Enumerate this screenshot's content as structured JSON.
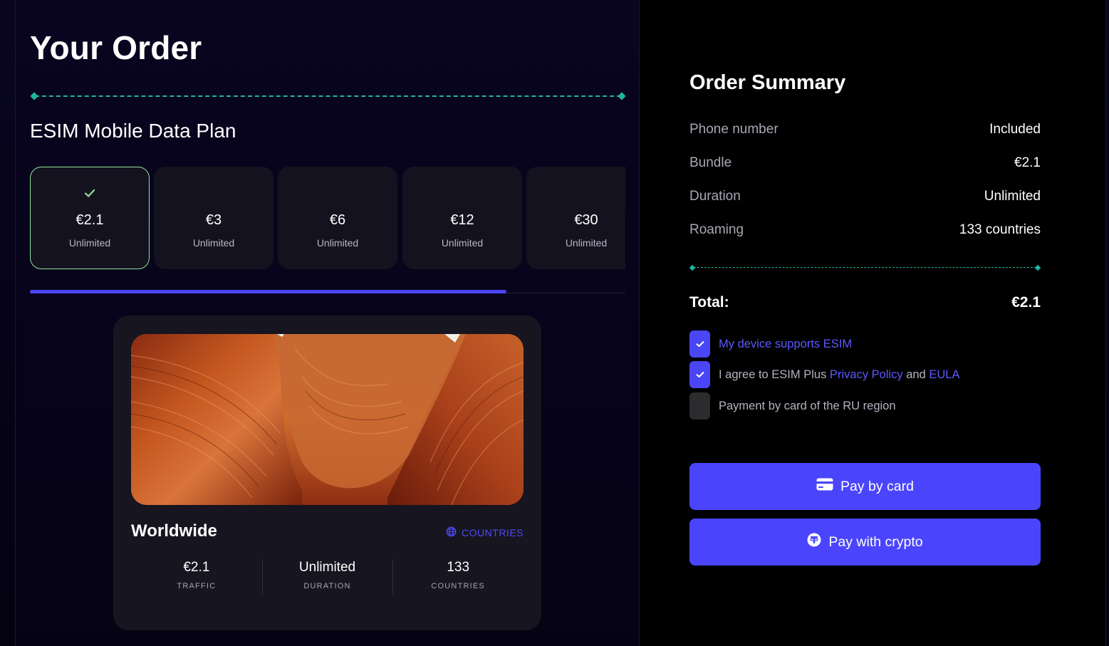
{
  "page": {
    "title": "Your Order",
    "plan_heading": "ESIM Mobile Data Plan"
  },
  "plans": [
    {
      "price": "€2.1",
      "duration": "Unlimited",
      "selected": true
    },
    {
      "price": "€3",
      "duration": "Unlimited",
      "selected": false
    },
    {
      "price": "€6",
      "duration": "Unlimited",
      "selected": false
    },
    {
      "price": "€12",
      "duration": "Unlimited",
      "selected": false
    },
    {
      "price": "€30",
      "duration": "Unlimited",
      "selected": false
    }
  ],
  "plans_scroll_fraction": 0.8,
  "destination": {
    "name": "Worldwide",
    "countries_link": "COUNTRIES",
    "stats": [
      {
        "value": "€2.1",
        "label": "TRAFFIC"
      },
      {
        "value": "Unlimited",
        "label": "DURATION"
      },
      {
        "value": "133",
        "label": "COUNTRIES"
      }
    ]
  },
  "summary": {
    "title": "Order Summary",
    "rows": [
      {
        "key": "Phone number",
        "value": "Included"
      },
      {
        "key": "Bundle",
        "value": "€2.1"
      },
      {
        "key": "Duration",
        "value": "Unlimited"
      },
      {
        "key": "Roaming",
        "value": "133 countries"
      }
    ],
    "total_label": "Total:",
    "total_value": "€2.1"
  },
  "agreements": {
    "esim_support": {
      "text": "My device supports ESIM",
      "checked": true
    },
    "terms": {
      "prefix": "I agree to ESIM Plus ",
      "privacy": "Privacy Policy",
      "and": " and ",
      "eula": "EULA",
      "checked": true
    },
    "ru_card": {
      "text": "Payment by card of the RU region",
      "checked": false
    }
  },
  "buttons": {
    "pay_card": "Pay by card",
    "pay_crypto": "Pay with crypto"
  },
  "colors": {
    "accent": "#4a45f5",
    "teal": "#1fb5a2",
    "selected_border": "#8fe39a",
    "card_bg": "#15121f"
  },
  "icons": {
    "check": "check-icon",
    "globe": "globe-icon",
    "card": "credit-card-icon",
    "crypto": "tether-icon"
  }
}
